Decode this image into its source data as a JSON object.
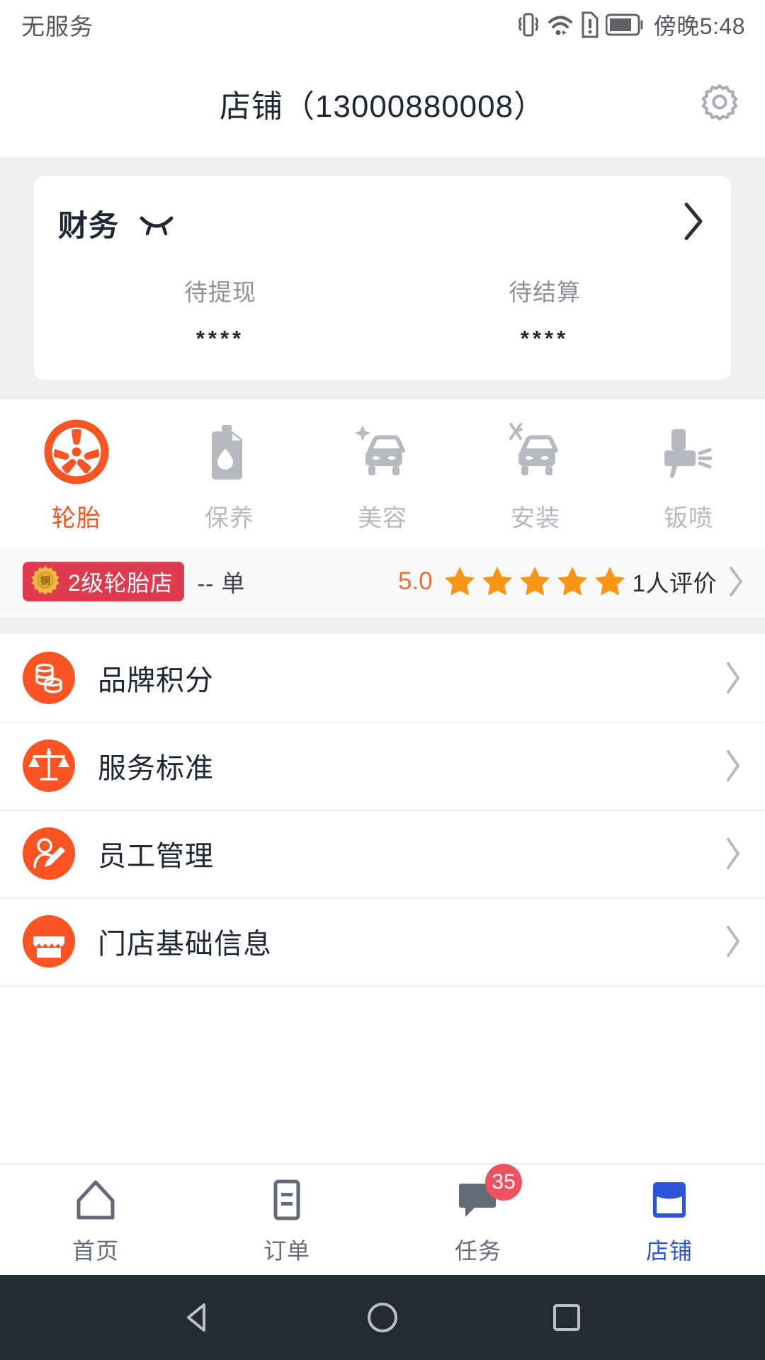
{
  "status_bar": {
    "carrier": "无服务",
    "time": "傍晚5:48",
    "icons": [
      "vibrate-icon",
      "wifi-icon",
      "sim-alert-icon",
      "battery-icon"
    ]
  },
  "header": {
    "title": "店铺（13000880008）",
    "settings_icon": "gear-icon"
  },
  "finance": {
    "title": "财务",
    "toggle_icon": "eye-closed-icon",
    "arrow_icon": "chevron-right-icon",
    "stats": [
      {
        "label": "待提现",
        "value": "****"
      },
      {
        "label": "待结算",
        "value": "****"
      }
    ]
  },
  "categories": [
    {
      "label": "轮胎",
      "icon": "tire-icon",
      "active": true
    },
    {
      "label": "保养",
      "icon": "oil-can-icon",
      "active": false
    },
    {
      "label": "美容",
      "icon": "car-sparkle-icon",
      "active": false
    },
    {
      "label": "安装",
      "icon": "car-wrench-icon",
      "active": false
    },
    {
      "label": "钣喷",
      "icon": "spray-gun-icon",
      "active": false
    }
  ],
  "rating_row": {
    "badge_icon": "bronze-medal-icon",
    "badge_medal_text": "铜",
    "badge_label": "2级轮胎店",
    "order_count": "-- 单",
    "score": "5.0",
    "stars_filled": 5,
    "reviews": "1人评价",
    "arrow_icon": "chevron-right-icon"
  },
  "menu_items": [
    {
      "label": "品牌积分",
      "icon": "coins-icon"
    },
    {
      "label": "服务标准",
      "icon": "scales-icon"
    },
    {
      "label": "员工管理",
      "icon": "employee-icon"
    },
    {
      "label": "门店基础信息",
      "icon": "storefront-icon"
    }
  ],
  "tab_bar": [
    {
      "label": "首页",
      "icon": "home-icon",
      "active": false,
      "badge": ""
    },
    {
      "label": "订单",
      "icon": "order-icon",
      "active": false,
      "badge": ""
    },
    {
      "label": "任务",
      "icon": "task-chat-icon",
      "active": false,
      "badge": "35"
    },
    {
      "label": "店铺",
      "icon": "shop-icon",
      "active": true,
      "badge": ""
    }
  ],
  "android_nav": {
    "back": "back-triangle-icon",
    "home": "home-circle-icon",
    "recents": "recents-square-icon"
  },
  "colors": {
    "accent_orange": "#FA5423",
    "star_orange": "#FA9414",
    "badge_red": "#E03A4E",
    "tab_active_blue": "#2D54D8",
    "text_dark": "#1E2733",
    "text_gray": "#8E939B",
    "page_bg": "#EEEFF1"
  }
}
